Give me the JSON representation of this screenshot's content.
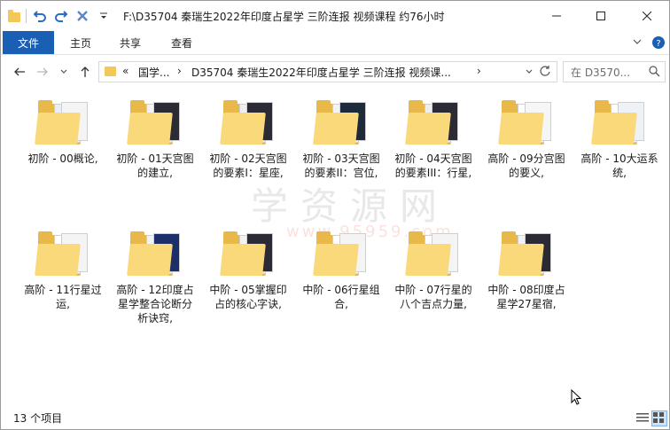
{
  "window": {
    "title": "F:\\D35704 秦瑞生2022年印度占星学 三阶连报 视频课程 约76小时"
  },
  "ribbon": {
    "tabs": [
      {
        "label": "文件"
      },
      {
        "label": "主页"
      },
      {
        "label": "共享"
      },
      {
        "label": "查看"
      }
    ]
  },
  "address": {
    "prefix": "«",
    "crumb1": "国学...",
    "crumb2": "D35704 秦瑞生2022年印度占星学 三阶连报 视频课...",
    "sep": "›"
  },
  "search": {
    "placeholder": "在 D3570..."
  },
  "watermark": {
    "text": "学资源网",
    "url": "www.95959.com"
  },
  "items": [
    {
      "label": "初阶 - 00概论,"
    },
    {
      "label": "初阶 - 01天宫图的建立,"
    },
    {
      "label": "初阶 - 02天宫图的要素I：星座,"
    },
    {
      "label": "初阶 - 03天宫图的要素II：宫位,"
    },
    {
      "label": "初阶 - 04天宫图的要素III：行星,"
    },
    {
      "label": "高阶 - 09分宫图的要义,"
    },
    {
      "label": "高阶 - 10大运系统,"
    },
    {
      "label": "高阶 - 11行星过运,"
    },
    {
      "label": "高阶 - 12印度占星学整合论断分析诀窍,"
    },
    {
      "label": "中阶 - 05掌握印占的核心字诀,"
    },
    {
      "label": "中阶 - 06行星组合,"
    },
    {
      "label": "中阶 - 07行星的八个吉点力量,"
    },
    {
      "label": "中阶 - 08印度占星学27星宿,"
    }
  ],
  "status": {
    "count": "13 个项目"
  },
  "colors": {
    "accent": "#1a5fb4",
    "folder": "#fad97a",
    "folder_back": "#e8b94a"
  }
}
